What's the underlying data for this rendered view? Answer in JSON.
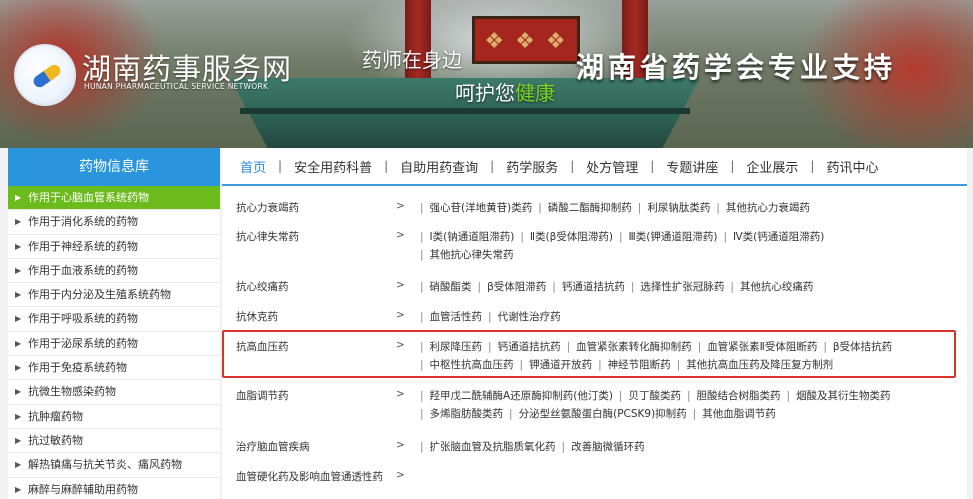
{
  "header": {
    "site_title": "湖南药事服务网",
    "site_subtitle": "HUNAN PHARMACEUTICAL SERVICE NETWORK",
    "slogan_line1": "药师在身边",
    "slogan_line2_prefix": "呵护您",
    "slogan_line2_highlight": "健康",
    "slogan_big": "湖南省药学会专业支持",
    "accent_color": "#7ed321"
  },
  "sidebar": {
    "title": "药物信息库",
    "header_color": "#2a95dd",
    "active_color": "#6bbb1c",
    "items": [
      {
        "label": "作用于心脑血管系统药物",
        "active": true
      },
      {
        "label": "作用于消化系统的药物"
      },
      {
        "label": "作用于神经系统的药物"
      },
      {
        "label": "作用于血液系统的药物"
      },
      {
        "label": "作用于内分泌及生殖系统药物"
      },
      {
        "label": "作用于呼吸系统的药物"
      },
      {
        "label": "作用于泌尿系统的药物"
      },
      {
        "label": "作用于免疫系统药物"
      },
      {
        "label": "抗微生物感染药物"
      },
      {
        "label": "抗肿瘤药物"
      },
      {
        "label": "抗过敏药物"
      },
      {
        "label": "解热镇痛与抗关节炎、痛风药物"
      },
      {
        "label": "麻醉与麻醉辅助用药物"
      }
    ]
  },
  "nav": {
    "items": [
      "首页",
      "安全用药科普",
      "自助用药查询",
      "药学服务",
      "处方管理",
      "专题讲座",
      "企业展示",
      "药讯中心"
    ],
    "active_index": 0,
    "separator": "|"
  },
  "categories": [
    {
      "name": "抗心力衰竭药",
      "arrow": ">",
      "lines": [
        [
          "强心苷(洋地黄苷)类药",
          "磷酸二酯酶抑制药",
          "利尿钠肽类药",
          "其他抗心力衰竭药"
        ]
      ]
    },
    {
      "name": "抗心律失常药",
      "arrow": ">",
      "lines": [
        [
          "Ⅰ类(钠通道阻滞药)",
          "Ⅱ类(β受体阻滞药)",
          "Ⅲ类(钾通道阻滞药)",
          "Ⅳ类(钙通道阻滞药)"
        ],
        [
          "其他抗心律失常药"
        ]
      ]
    },
    {
      "name": "抗心绞痛药",
      "arrow": ">",
      "lines": [
        [
          "硝酸酯类",
          "β受体阻滞药",
          "钙通道拮抗药",
          "选择性扩张冠脉药",
          "其他抗心绞痛药"
        ]
      ]
    },
    {
      "name": "抗休克药",
      "arrow": ">",
      "lines": [
        [
          "血管活性药",
          "代谢性治疗药"
        ]
      ]
    },
    {
      "name": "抗高血压药",
      "arrow": ">",
      "highlighted": true,
      "lines": [
        [
          "利尿降压药",
          "钙通道拮抗药",
          "血管紧张素转化酶抑制药",
          "血管紧张素Ⅱ受体阻断药",
          "β受体拮抗药"
        ],
        [
          "中枢性抗高血压药",
          "钾通道开放药",
          "神经节阻断药",
          "其他抗高血压药及降压复方制剂"
        ]
      ]
    },
    {
      "name": "血脂调节药",
      "arrow": ">",
      "lines": [
        [
          "羟甲戊二酰辅酶A还原酶抑制药(他汀类)",
          "贝丁酸类药",
          "胆酸结合树脂类药",
          "烟酸及其衍生物类药"
        ],
        [
          "多烯脂肪酸类药",
          "分泌型丝氨酸蛋白酶(PCSK9)抑制药",
          "其他血脂调节药"
        ]
      ]
    },
    {
      "name": "治疗脑血管疾病",
      "arrow": ">",
      "lines": [
        [
          "扩张脑血管及抗脂质氧化药",
          "改善脑微循环药"
        ]
      ]
    },
    {
      "name": "血管硬化药及影响血管通透性药",
      "arrow": ">",
      "lines": [
        []
      ]
    }
  ],
  "highlight_color": "#d8332f"
}
